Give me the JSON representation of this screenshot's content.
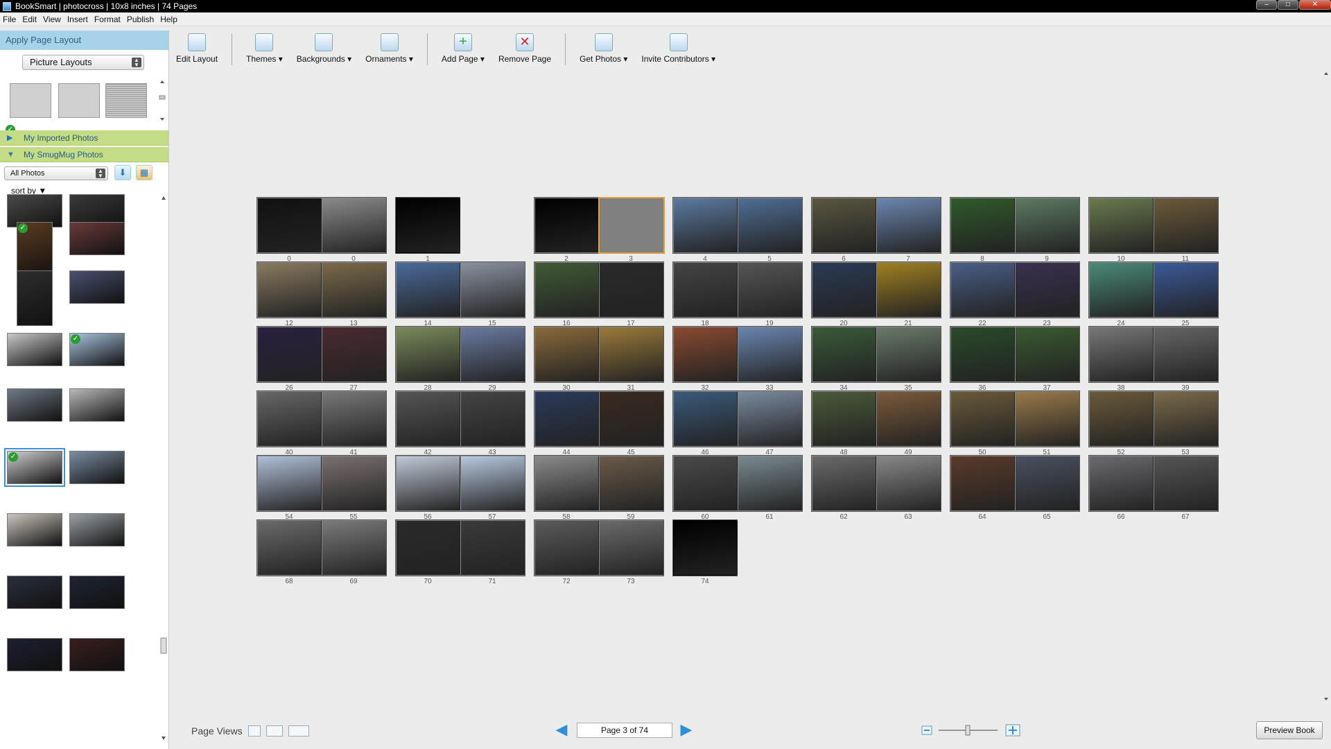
{
  "window": {
    "title": "BookSmart  |  photocross  |  10x8 inches  |  74 Pages",
    "controls": [
      "minimize",
      "maximize",
      "close"
    ]
  },
  "menu": [
    "File",
    "Edit",
    "View",
    "Insert",
    "Format",
    "Publish",
    "Help"
  ],
  "left_panel": {
    "header": "Apply Page Layout",
    "layout_select": "Picture Layouts",
    "imported_label": "My Imported Photos",
    "smugmug_label": "My SmugMug Photos",
    "photo_filter": "All Photos",
    "sort_label": "sort by ▼",
    "photos": [
      {
        "color": "#4a4a4a",
        "checked": false
      },
      {
        "color": "#3a3a3a",
        "checked": false
      },
      {
        "color": "#5a3b1f",
        "checked": true
      },
      {
        "color": "#6b3a3a",
        "checked": false
      },
      {
        "color": "#2d2d2d",
        "checked": false
      },
      {
        "color": "#4a5070",
        "checked": false
      },
      {
        "color": "#c7c7c7",
        "checked": false
      },
      {
        "color": "#a9c4e0",
        "checked": true
      },
      {
        "color": "#6f7a86",
        "checked": false
      },
      {
        "color": "#b9b9b9",
        "checked": false
      },
      {
        "color": "#d0d0d0",
        "checked": true,
        "selected": true
      },
      {
        "color": "#7b8da3",
        "checked": false
      },
      {
        "color": "#cdc5bd",
        "checked": false
      },
      {
        "color": "#9aa1a6",
        "checked": false
      },
      {
        "color": "#2a2f3e",
        "checked": false
      },
      {
        "color": "#1e2433",
        "checked": false
      },
      {
        "color": "#1c2030",
        "checked": false
      },
      {
        "color": "#3a1e1e",
        "checked": false
      }
    ]
  },
  "toolbar": [
    {
      "label": "Edit Layout",
      "icon": "edit-layout-icon"
    },
    {
      "label": "Themes ▾",
      "icon": "themes-icon"
    },
    {
      "label": "Backgrounds ▾",
      "icon": "backgrounds-icon"
    },
    {
      "label": "Ornaments ▾",
      "icon": "ornaments-icon"
    },
    {
      "label": "Add Page ▾",
      "icon": "add-page-icon"
    },
    {
      "label": "Remove Page",
      "icon": "remove-page-icon"
    },
    {
      "label": "Get Photos ▾",
      "icon": "get-photos-icon"
    },
    {
      "label": "Invite Contributors ▾",
      "icon": "invite-contributors-icon"
    }
  ],
  "spreads": [
    {
      "left": "0",
      "right": "0",
      "lc": "#111",
      "rc": "#8a8a8a",
      "extra": "0 0"
    },
    {
      "left": "1",
      "right": "",
      "lc": "#000",
      "rc": "#000"
    },
    {
      "left": "2",
      "right": "3",
      "lc": "#000",
      "rc": "#808080",
      "selected": true
    },
    {
      "left": "4",
      "right": "5",
      "lc": "#5b7aa0",
      "rc": "#4f6e95"
    },
    {
      "left": "6",
      "right": "7",
      "lc": "#5a5640",
      "rc": "#6b86b0"
    },
    {
      "left": "8",
      "right": "9",
      "lc": "#2f5a2a",
      "rc": "#5d7a62"
    },
    {
      "left": "10",
      "right": "11",
      "lc": "#6a7a4e",
      "rc": "#6b5a3a"
    },
    {
      "left": "12",
      "right": "13",
      "lc": "#8a7a60",
      "rc": "#7a6a4a"
    },
    {
      "left": "14",
      "right": "15",
      "lc": "#4a6a9a",
      "rc": "#8a92a0"
    },
    {
      "left": "16",
      "right": "17",
      "lc": "#405a35",
      "rc": "#2a2a2a"
    },
    {
      "left": "18",
      "right": "19",
      "lc": "#444",
      "rc": "#555"
    },
    {
      "left": "20",
      "right": "21",
      "lc": "#2a3a55",
      "rc": "#a08020"
    },
    {
      "left": "22",
      "right": "23",
      "lc": "#4a5e86",
      "rc": "#3a3050"
    },
    {
      "left": "24",
      "right": "25",
      "lc": "#4a8a7a",
      "rc": "#3a5a9a"
    },
    {
      "left": "26",
      "right": "27",
      "lc": "#2a2040",
      "rc": "#4a2a30"
    },
    {
      "left": "28",
      "right": "29",
      "lc": "#7a8a5a",
      "rc": "#6a7aa0"
    },
    {
      "left": "30",
      "right": "31",
      "lc": "#8a6a3a",
      "rc": "#9a7a3a"
    },
    {
      "left": "32",
      "right": "33",
      "lc": "#8a4a30",
      "rc": "#6a86b0"
    },
    {
      "left": "34",
      "right": "35",
      "lc": "#3a5a3a",
      "rc": "#6a7a6a"
    },
    {
      "left": "36",
      "right": "37",
      "lc": "#2a4a2a",
      "rc": "#3a5a30"
    },
    {
      "left": "38",
      "right": "39",
      "lc": "#777",
      "rc": "#666"
    },
    {
      "left": "40",
      "right": "41",
      "lc": "#666",
      "rc": "#777"
    },
    {
      "left": "42",
      "right": "43",
      "lc": "#555",
      "rc": "#444"
    },
    {
      "left": "44",
      "right": "45",
      "lc": "#2a3a5a",
      "rc": "#3a2a20"
    },
    {
      "left": "46",
      "right": "47",
      "lc": "#3a5a7a",
      "rc": "#7a8aa0"
    },
    {
      "left": "48",
      "right": "49",
      "lc": "#4a5a3a",
      "rc": "#7a5a3a"
    },
    {
      "left": "50",
      "right": "51",
      "lc": "#6a5a3a",
      "rc": "#9a7a4a"
    },
    {
      "left": "52",
      "right": "53",
      "lc": "#6a5a3a",
      "rc": "#7a6a4a"
    },
    {
      "left": "54",
      "right": "55",
      "lc": "#b0c0d8",
      "rc": "#7a7070"
    },
    {
      "left": "56",
      "right": "57",
      "lc": "#c0cad8",
      "rc": "#b8c8e0"
    },
    {
      "left": "58",
      "right": "59",
      "lc": "#8a8a8a",
      "rc": "#6a5a4a"
    },
    {
      "left": "60",
      "right": "61",
      "lc": "#4a4a4a",
      "rc": "#7a8a90"
    },
    {
      "left": "62",
      "right": "63",
      "lc": "#6a6a6a",
      "rc": "#888"
    },
    {
      "left": "64",
      "right": "65",
      "lc": "#5a3a2a",
      "rc": "#4a5060"
    },
    {
      "left": "66",
      "right": "67",
      "lc": "#6a6a70",
      "rc": "#555"
    },
    {
      "left": "68",
      "right": "69",
      "lc": "#6a6a6a",
      "rc": "#7a7a7a"
    },
    {
      "left": "70",
      "right": "71",
      "lc": "#2a2a2a",
      "rc": "#3a3a3a"
    },
    {
      "left": "72",
      "right": "73",
      "lc": "#5a5a5a",
      "rc": "#6a6a6a"
    },
    {
      "left": "74",
      "right": "",
      "lc": "#000",
      "rc": "#000"
    }
  ],
  "bottom": {
    "page_views_label": "Page Views",
    "page_indicator": "Page 3 of 74",
    "preview_label": "Preview Book"
  },
  "colors": {
    "accent": "#2d8fd8",
    "selection": "#e8a13a",
    "panel_header": "#a7d3ea",
    "accordion": "#c3dc86"
  }
}
